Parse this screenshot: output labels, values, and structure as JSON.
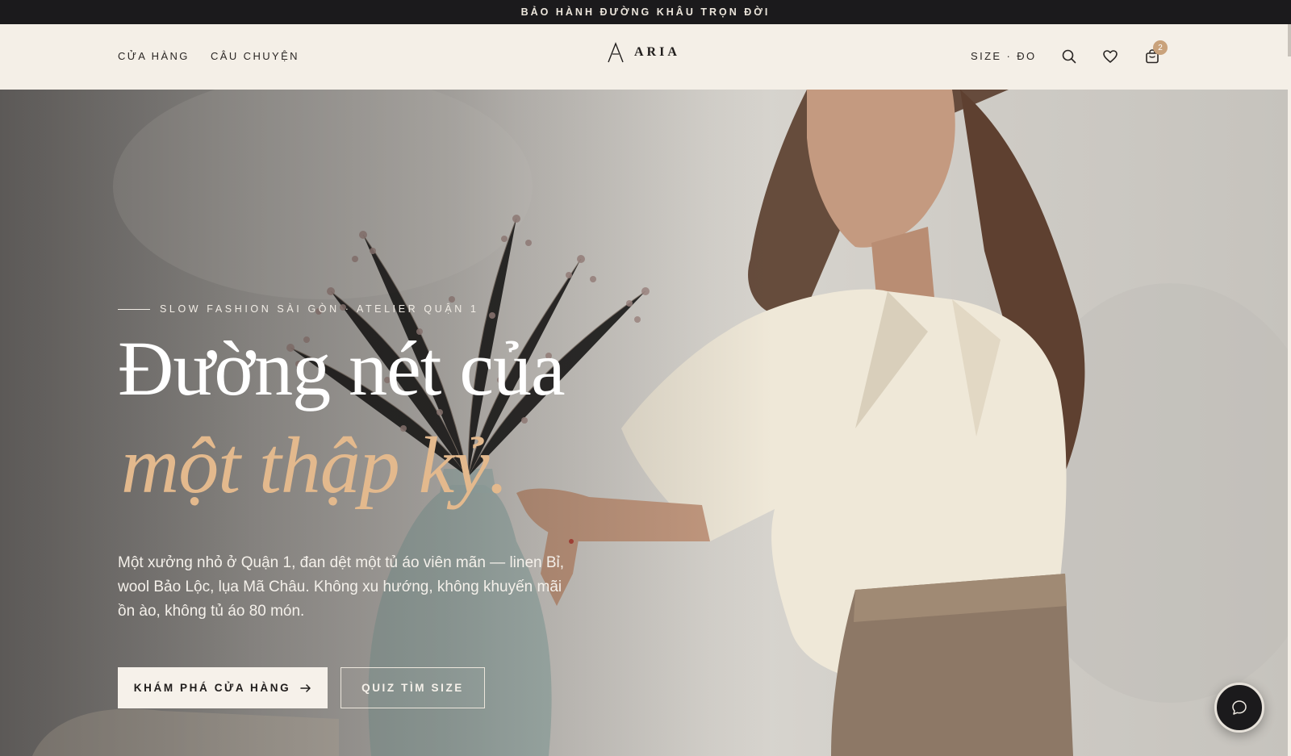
{
  "announcement": "BẢO HÀNH ĐƯỜNG KHÂU TRỌN ĐỜI",
  "header": {
    "nav": [
      "CỬA HÀNG",
      "CÂU CHUYỆN"
    ],
    "logo_text": "ARIA",
    "size_link": "SIZE · ĐO",
    "cart_count": "2"
  },
  "hero": {
    "eyebrow": "SLOW FASHION SÀI GÒN · ATELIER QUẬN 1",
    "headline_line1": "Đường nét của",
    "headline_line2": "một thập kỷ.",
    "description": "Một xưởng nhỏ ở Quận 1, đan dệt một tủ áo viên mãn — linen Bỉ, wool Bảo Lộc, lụa Mã Châu. Không xu hướng, không khuyến mãi ồn ào, không tủ áo 80 món.",
    "primary_cta": "KHÁM PHÁ CỬA HÀNG",
    "secondary_cta": "QUIZ TÌM SIZE"
  },
  "colors": {
    "accent_gold": "#e3b98d",
    "header_bg": "#f4efe7",
    "dark": "#1b1a1c",
    "badge": "#c9a27b"
  },
  "icons": [
    "search-icon",
    "heart-icon",
    "shopping-bag-icon",
    "arrow-right-icon",
    "chat-icon"
  ]
}
